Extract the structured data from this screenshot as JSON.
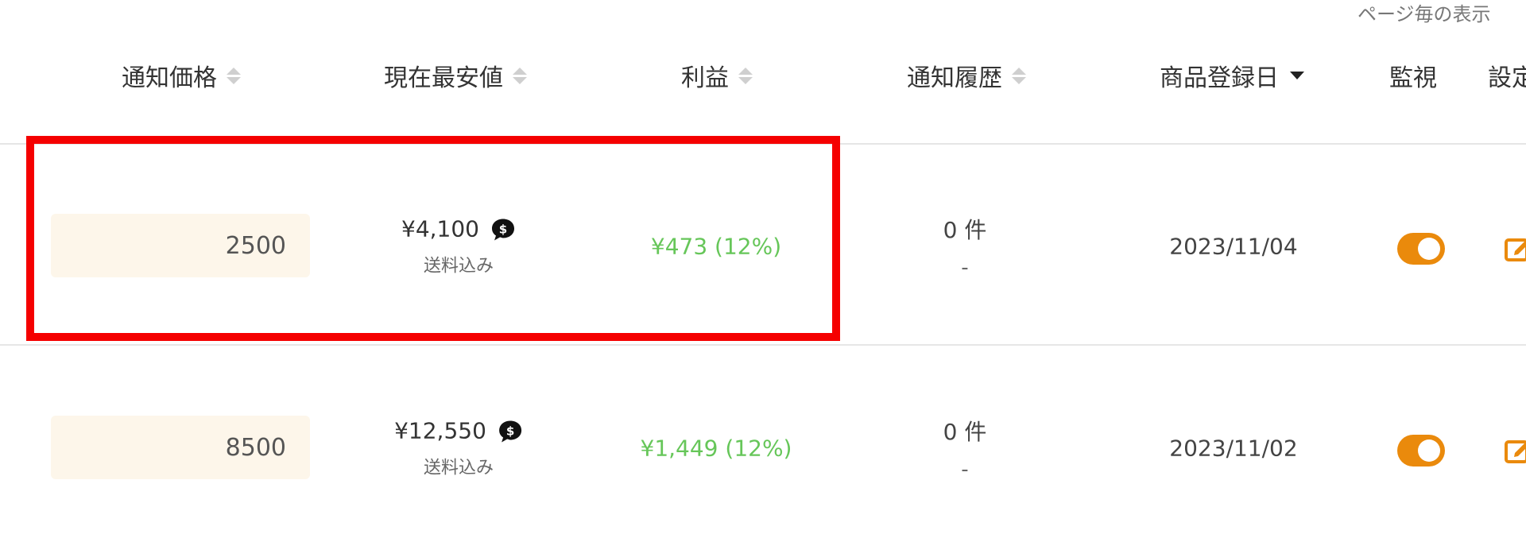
{
  "pagination": {
    "per_page_label": "ページ毎の表示"
  },
  "table": {
    "headers": {
      "notify_price": "通知価格",
      "current_lowest": "現在最安値",
      "profit": "利益",
      "notify_history": "通知履歴",
      "registered_date": "商品登録日",
      "monitor": "監視",
      "settings": "設定"
    },
    "rows": [
      {
        "notify_price": "2500",
        "current_lowest": "¥4,100",
        "shipping_note": "送料込み",
        "profit": "¥473 (12%)",
        "history_count": "0 件",
        "history_last": "-",
        "registered_date": "2023/11/04",
        "monitor_on": true
      },
      {
        "notify_price": "8500",
        "current_lowest": "¥12,550",
        "shipping_note": "送料込み",
        "profit": "¥1,449 (12%)",
        "history_count": "0 件",
        "history_last": "-",
        "registered_date": "2023/11/02",
        "monitor_on": true
      }
    ]
  },
  "colors": {
    "highlight": "#f50000",
    "profit": "#66c659",
    "toggle_on": "#ea8a0c",
    "input_bg": "#fdf6ea"
  },
  "icons": {
    "price_chat": "chat-bubble-dollar-icon",
    "sort": "sort-icon",
    "sort_desc": "caret-down-icon",
    "edit": "edit-icon"
  }
}
